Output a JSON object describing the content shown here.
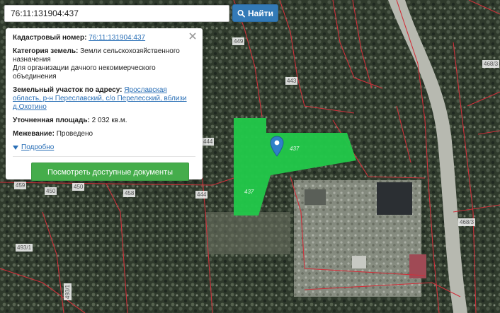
{
  "search": {
    "value": "76:11:131904:437"
  },
  "find_button": {
    "label": "Найти"
  },
  "popup": {
    "cadastral_label": "Кадастровый номер:",
    "cadastral_value": "76:11:131904:437",
    "category_label": "Категория земель:",
    "category_value": "Земли сельскохозяйственного назначения",
    "use_value": "Для организации дачного некоммерческого объединения",
    "address_label": "Земельный участок по адресу:",
    "address_value": "Ярославская область, р-н Переславский, с/о Перелесский, вблизи д.Охотино",
    "area_label": "Уточненная площадь:",
    "area_value": "2 032 кв.м.",
    "survey_label": "Межевание:",
    "survey_value": "Проведено",
    "more_label": "Подробно",
    "docs_button": "Посмотреть доступные документы"
  },
  "map_labels": {
    "l449": "449",
    "l443": "443",
    "l444a": "444",
    "l444b": "444",
    "l437a": "437",
    "l437b": "437",
    "l459": "459",
    "l450a": "450",
    "l450b": "450",
    "l458": "458",
    "l468_3a": "468/3",
    "l468_3b": "468/3",
    "l493_1": "493/1",
    "l493_1b": "493/1"
  },
  "colors": {
    "parcel_fill": "#22c94a",
    "boundary": "#d0303a",
    "button_primary": "#337ab7",
    "button_success": "#45ad4b"
  }
}
